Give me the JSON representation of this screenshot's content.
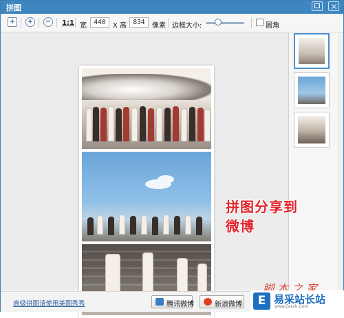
{
  "window": {
    "title": "拼图"
  },
  "toolbar": {
    "add_icon": "plus-square-icon",
    "zoom_in_icon": "zoom-in-icon",
    "zoom_out_icon": "zoom-out-icon",
    "actual_size_label": "1:1",
    "width_label": "宽",
    "width_value": "440",
    "height_label": "X 高",
    "height_value": "834",
    "unit_label": "像素",
    "border_label": "边框大小:",
    "border_level": 0.3,
    "rounded_label": "圆角",
    "rounded_checked": false
  },
  "thumbnails": [
    {
      "selected": true
    },
    {
      "selected": false
    },
    {
      "selected": false
    }
  ],
  "footer": {
    "link_text": "高级拼图请使用美图秀秀",
    "tencent_label": "腾讯微博",
    "sina_label": "新浪微博"
  },
  "overlay": {
    "line1": "拼图分享到",
    "line2": "微博"
  },
  "watermark": {
    "jb": "脚本之家",
    "site_name": "易采站长站",
    "site_url": "www.Easck.Com"
  },
  "colors": {
    "titlebar": "#3d86c0",
    "accent": "#4a8ed0",
    "overlay": "#e3242b"
  }
}
